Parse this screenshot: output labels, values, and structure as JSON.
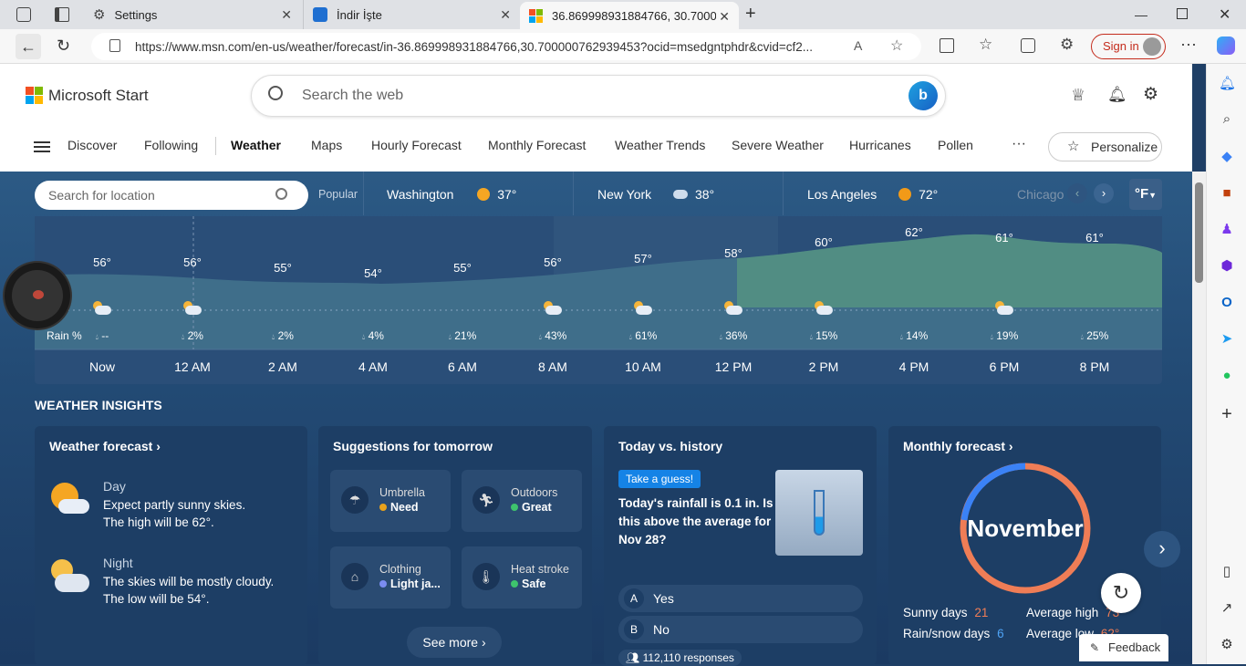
{
  "tabs": [
    {
      "label": "Settings",
      "icon": "gear-icon"
    },
    {
      "label": "İndir İşte",
      "icon": "download-site-icon"
    },
    {
      "label": "36.869998931884766, 30.70000",
      "icon": "msn-icon"
    }
  ],
  "address": {
    "url": "https://www.msn.com/en-us/weather/forecast/in-36.869998931884766,30.700000762939453?ocid=msedgntphdr&cvid=cf2...",
    "sign_in": "Sign in"
  },
  "header": {
    "brand": "Microsoft Start",
    "search_placeholder": "Search the web"
  },
  "nav": [
    "Discover",
    "Following",
    "Weather",
    "Maps",
    "Hourly Forecast",
    "Monthly Forecast",
    "Weather Trends",
    "Severe Weather",
    "Hurricanes",
    "Pollen"
  ],
  "nav_more": "···",
  "personalize": "Personalize",
  "locbar": {
    "placeholder": "Search for location",
    "popular": "Popular",
    "unit": "°F",
    "cities": [
      {
        "name": "Washington",
        "temp": "37°"
      },
      {
        "name": "New York",
        "temp": "38°"
      },
      {
        "name": "Los Angeles",
        "temp": "72°"
      },
      {
        "name": "Chicago",
        "temp": ""
      }
    ]
  },
  "hourly": {
    "rain_label": "Rain %",
    "hours": [
      "Now",
      "12 AM",
      "2 AM",
      "4 AM",
      "6 AM",
      "8 AM",
      "10 AM",
      "12 PM",
      "2 PM",
      "4 PM",
      "6 PM",
      "8 PM"
    ],
    "temps": [
      "56°",
      "56°",
      "55°",
      "54°",
      "55°",
      "56°",
      "57°",
      "58°",
      "60°",
      "62°",
      "61°",
      "61°"
    ],
    "rain": [
      "--",
      "2%",
      "2%",
      "4%",
      "21%",
      "43%",
      "61%",
      "36%",
      "15%",
      "14%",
      "19%",
      "25%"
    ]
  },
  "insights": {
    "title": "WEATHER INSIGHTS",
    "forecast": {
      "title": "Weather forecast",
      "day_label": "Day",
      "day_text1": "Expect partly sunny skies.",
      "day_text2": "The high will be 62°.",
      "night_label": "Night",
      "night_text1": "The skies will be mostly cloudy.",
      "night_text2": "The low will be 54°."
    },
    "suggestions": {
      "title": "Suggestions for tomorrow",
      "items": [
        {
          "label": "Umbrella",
          "value": "Need",
          "color": "#e8a21c"
        },
        {
          "label": "Outdoors",
          "value": "Great",
          "color": "#3ec46d"
        },
        {
          "label": "Clothing",
          "value": "Light ja...",
          "color": "#7b8cf0"
        },
        {
          "label": "Heat stroke",
          "value": "Safe",
          "color": "#3ec46d"
        }
      ],
      "see_more": "See more"
    },
    "history": {
      "title": "Today vs. history",
      "badge": "Take a guess!",
      "question": "Today's rainfall is 0.1 in. Is this above the average for Nov 28?",
      "options": [
        {
          "key": "A",
          "label": "Yes"
        },
        {
          "key": "B",
          "label": "No"
        }
      ],
      "responses": "112,110 responses"
    },
    "monthly": {
      "title": "Monthly forecast",
      "month": "November",
      "sunny_label": "Sunny days",
      "sunny": "21",
      "rain_label": "Rain/snow days",
      "rain": "6",
      "high_label": "Average high",
      "high": "73°",
      "low_label": "Average low",
      "low": "62°"
    }
  },
  "feedback": "Feedback"
}
